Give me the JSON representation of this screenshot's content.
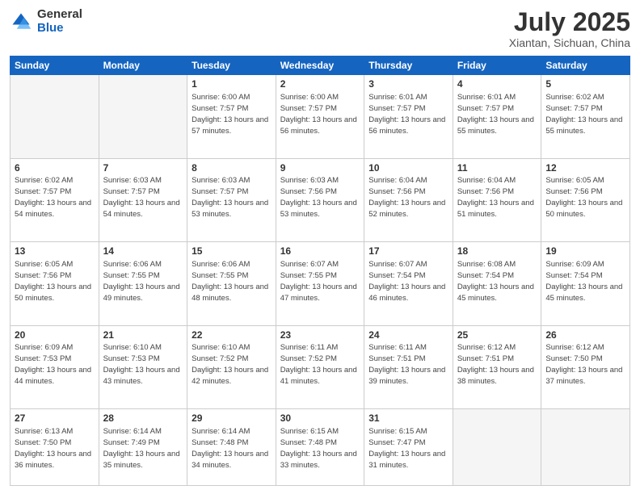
{
  "header": {
    "logo_general": "General",
    "logo_blue": "Blue",
    "title": "July 2025",
    "subtitle": "Xiantan, Sichuan, China"
  },
  "days_of_week": [
    "Sunday",
    "Monday",
    "Tuesday",
    "Wednesday",
    "Thursday",
    "Friday",
    "Saturday"
  ],
  "weeks": [
    [
      {
        "day": "",
        "info": ""
      },
      {
        "day": "",
        "info": ""
      },
      {
        "day": "1",
        "info": "Sunrise: 6:00 AM\nSunset: 7:57 PM\nDaylight: 13 hours and 57 minutes."
      },
      {
        "day": "2",
        "info": "Sunrise: 6:00 AM\nSunset: 7:57 PM\nDaylight: 13 hours and 56 minutes."
      },
      {
        "day": "3",
        "info": "Sunrise: 6:01 AM\nSunset: 7:57 PM\nDaylight: 13 hours and 56 minutes."
      },
      {
        "day": "4",
        "info": "Sunrise: 6:01 AM\nSunset: 7:57 PM\nDaylight: 13 hours and 55 minutes."
      },
      {
        "day": "5",
        "info": "Sunrise: 6:02 AM\nSunset: 7:57 PM\nDaylight: 13 hours and 55 minutes."
      }
    ],
    [
      {
        "day": "6",
        "info": "Sunrise: 6:02 AM\nSunset: 7:57 PM\nDaylight: 13 hours and 54 minutes."
      },
      {
        "day": "7",
        "info": "Sunrise: 6:03 AM\nSunset: 7:57 PM\nDaylight: 13 hours and 54 minutes."
      },
      {
        "day": "8",
        "info": "Sunrise: 6:03 AM\nSunset: 7:57 PM\nDaylight: 13 hours and 53 minutes."
      },
      {
        "day": "9",
        "info": "Sunrise: 6:03 AM\nSunset: 7:56 PM\nDaylight: 13 hours and 53 minutes."
      },
      {
        "day": "10",
        "info": "Sunrise: 6:04 AM\nSunset: 7:56 PM\nDaylight: 13 hours and 52 minutes."
      },
      {
        "day": "11",
        "info": "Sunrise: 6:04 AM\nSunset: 7:56 PM\nDaylight: 13 hours and 51 minutes."
      },
      {
        "day": "12",
        "info": "Sunrise: 6:05 AM\nSunset: 7:56 PM\nDaylight: 13 hours and 50 minutes."
      }
    ],
    [
      {
        "day": "13",
        "info": "Sunrise: 6:05 AM\nSunset: 7:56 PM\nDaylight: 13 hours and 50 minutes."
      },
      {
        "day": "14",
        "info": "Sunrise: 6:06 AM\nSunset: 7:55 PM\nDaylight: 13 hours and 49 minutes."
      },
      {
        "day": "15",
        "info": "Sunrise: 6:06 AM\nSunset: 7:55 PM\nDaylight: 13 hours and 48 minutes."
      },
      {
        "day": "16",
        "info": "Sunrise: 6:07 AM\nSunset: 7:55 PM\nDaylight: 13 hours and 47 minutes."
      },
      {
        "day": "17",
        "info": "Sunrise: 6:07 AM\nSunset: 7:54 PM\nDaylight: 13 hours and 46 minutes."
      },
      {
        "day": "18",
        "info": "Sunrise: 6:08 AM\nSunset: 7:54 PM\nDaylight: 13 hours and 45 minutes."
      },
      {
        "day": "19",
        "info": "Sunrise: 6:09 AM\nSunset: 7:54 PM\nDaylight: 13 hours and 45 minutes."
      }
    ],
    [
      {
        "day": "20",
        "info": "Sunrise: 6:09 AM\nSunset: 7:53 PM\nDaylight: 13 hours and 44 minutes."
      },
      {
        "day": "21",
        "info": "Sunrise: 6:10 AM\nSunset: 7:53 PM\nDaylight: 13 hours and 43 minutes."
      },
      {
        "day": "22",
        "info": "Sunrise: 6:10 AM\nSunset: 7:52 PM\nDaylight: 13 hours and 42 minutes."
      },
      {
        "day": "23",
        "info": "Sunrise: 6:11 AM\nSunset: 7:52 PM\nDaylight: 13 hours and 41 minutes."
      },
      {
        "day": "24",
        "info": "Sunrise: 6:11 AM\nSunset: 7:51 PM\nDaylight: 13 hours and 39 minutes."
      },
      {
        "day": "25",
        "info": "Sunrise: 6:12 AM\nSunset: 7:51 PM\nDaylight: 13 hours and 38 minutes."
      },
      {
        "day": "26",
        "info": "Sunrise: 6:12 AM\nSunset: 7:50 PM\nDaylight: 13 hours and 37 minutes."
      }
    ],
    [
      {
        "day": "27",
        "info": "Sunrise: 6:13 AM\nSunset: 7:50 PM\nDaylight: 13 hours and 36 minutes."
      },
      {
        "day": "28",
        "info": "Sunrise: 6:14 AM\nSunset: 7:49 PM\nDaylight: 13 hours and 35 minutes."
      },
      {
        "day": "29",
        "info": "Sunrise: 6:14 AM\nSunset: 7:48 PM\nDaylight: 13 hours and 34 minutes."
      },
      {
        "day": "30",
        "info": "Sunrise: 6:15 AM\nSunset: 7:48 PM\nDaylight: 13 hours and 33 minutes."
      },
      {
        "day": "31",
        "info": "Sunrise: 6:15 AM\nSunset: 7:47 PM\nDaylight: 13 hours and 31 minutes."
      },
      {
        "day": "",
        "info": ""
      },
      {
        "day": "",
        "info": ""
      }
    ]
  ]
}
